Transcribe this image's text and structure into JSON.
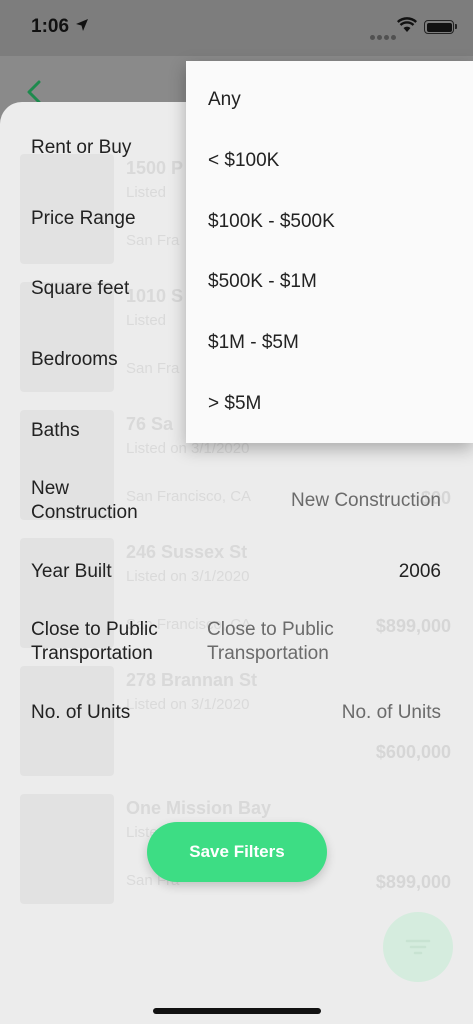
{
  "status_bar": {
    "time": "1:06"
  },
  "listings": [
    {
      "address": "1500 P",
      "listed": "Listed",
      "city": "San Fra",
      "price": ""
    },
    {
      "address": "1010 S",
      "listed": "Listed",
      "city": "San Fra",
      "price": ""
    },
    {
      "address": "76 Sa",
      "listed": "Listed on 3/1/2020",
      "city": "San Francisco, CA",
      "price": "$00"
    },
    {
      "address": "246 Sussex St",
      "listed": "Listed on 3/1/2020",
      "city": "San Francisco, CA",
      "price": "$899,000"
    },
    {
      "address": "278 Brannan St",
      "listed": "Listed on 3/1/2020",
      "city": "",
      "price": "$600,000"
    },
    {
      "address": "One Mission Bay",
      "listed": "Listed",
      "city": "San Fra",
      "price": "$899,000"
    }
  ],
  "filters": {
    "rent_or_buy": {
      "label": "Rent or Buy"
    },
    "price_range": {
      "label": "Price Range"
    },
    "square_feet": {
      "label": "Square feet"
    },
    "bedrooms": {
      "label": "Bedrooms"
    },
    "baths": {
      "label": "Baths"
    },
    "new_construction": {
      "label_line1": "New",
      "label_line2": "Construction",
      "value": "New Construction"
    },
    "year_built": {
      "label": "Year Built",
      "value": "2006"
    },
    "transportation": {
      "label_line1": "Close to Public",
      "label_line2": "Transportation",
      "value_line1": "Close to Public",
      "value_line2": "Transportation"
    },
    "units": {
      "label": "No. of Units",
      "value": "No. of Units"
    }
  },
  "save_button": {
    "label": "Save Filters"
  },
  "price_dropdown": {
    "options": [
      "Any",
      "< $100K",
      "$100K - $500K",
      "$500K - $1M",
      "$1M - $5M",
      "> $5M"
    ]
  },
  "colors": {
    "accent": "#3ddd84",
    "back_arrow": "#1e8a4e"
  }
}
